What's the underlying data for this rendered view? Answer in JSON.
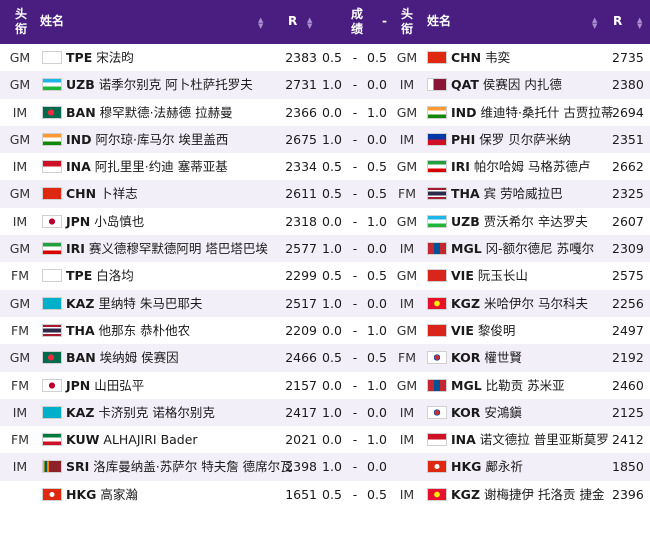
{
  "header": {
    "title_left_line1": "头",
    "title_left_line2": "衔",
    "name_left": "姓名",
    "rating_left": "R",
    "result_line1": "成",
    "result_line2": "绩",
    "dash": "-",
    "title_right_line1": "头",
    "title_right_line2": "衔",
    "name_right": "姓名",
    "rating_right": "R"
  },
  "colors": {
    "header_bg": "#4a1d80",
    "row_alt_bg": "#f3eff8"
  },
  "rows": [
    {
      "t1": "GM",
      "f1": "TPE",
      "n1": "宋法昀",
      "r1": "2383",
      "s1": "0.5",
      "d": "-",
      "s2": "0.5",
      "t2": "GM",
      "f2": "CHN",
      "n2": "韦奕",
      "r2": "2735"
    },
    {
      "t1": "GM",
      "f1": "UZB",
      "n1": "诺季尔别克 阿卜杜萨托罗夫",
      "r1": "2731",
      "s1": "1.0",
      "d": "-",
      "s2": "0.0",
      "t2": "IM",
      "f2": "QAT",
      "n2": "侯赛因 内扎德",
      "r2": "2380"
    },
    {
      "t1": "IM",
      "f1": "BAN",
      "n1": "穆罕默德·法赫德 拉赫曼",
      "r1": "2366",
      "s1": "0.0",
      "d": "-",
      "s2": "1.0",
      "t2": "GM",
      "f2": "IND",
      "n2": "维迪特·桑托什 古贾拉蒂",
      "r2": "2694"
    },
    {
      "t1": "GM",
      "f1": "IND",
      "n1": "阿尔琼·库马尔 埃里盖西",
      "r1": "2675",
      "s1": "1.0",
      "d": "-",
      "s2": "0.0",
      "t2": "IM",
      "f2": "PHI",
      "n2": "保罗 贝尔萨米纳",
      "r2": "2351"
    },
    {
      "t1": "IM",
      "f1": "INA",
      "n1": "阿扎里里·约迪 塞蒂亚基",
      "r1": "2334",
      "s1": "0.5",
      "d": "-",
      "s2": "0.5",
      "t2": "GM",
      "f2": "IRI",
      "n2": "帕尔哈姆 马格苏德卢",
      "r2": "2662"
    },
    {
      "t1": "GM",
      "f1": "CHN",
      "n1": "卜祥志",
      "r1": "2611",
      "s1": "0.5",
      "d": "-",
      "s2": "0.5",
      "t2": "FM",
      "f2": "THA",
      "n2": "宾 劳哈威拉巴",
      "r2": "2325"
    },
    {
      "t1": "IM",
      "f1": "JPN",
      "n1": "小岛慎也",
      "r1": "2318",
      "s1": "0.0",
      "d": "-",
      "s2": "1.0",
      "t2": "GM",
      "f2": "UZB",
      "n2": "贾沃希尔 辛达罗夫",
      "r2": "2607"
    },
    {
      "t1": "GM",
      "f1": "IRI",
      "n1": "赛义德穆罕默德阿明 塔巴塔巴埃",
      "r1": "2577",
      "s1": "1.0",
      "d": "-",
      "s2": "0.0",
      "t2": "IM",
      "f2": "MGL",
      "n2": "冈-额尔德尼 苏嘎尔",
      "r2": "2309"
    },
    {
      "t1": "FM",
      "f1": "TPE",
      "n1": "白洛均",
      "r1": "2299",
      "s1": "0.5",
      "d": "-",
      "s2": "0.5",
      "t2": "GM",
      "f2": "VIE",
      "n2": "阮玉长山",
      "r2": "2575"
    },
    {
      "t1": "GM",
      "f1": "KAZ",
      "n1": "里纳特 朱马巴耶夫",
      "r1": "2517",
      "s1": "1.0",
      "d": "-",
      "s2": "0.0",
      "t2": "IM",
      "f2": "KGZ",
      "n2": "米哈伊尔 马尔科夫",
      "r2": "2256"
    },
    {
      "t1": "FM",
      "f1": "THA",
      "n1": "他那东 恭朴他农",
      "r1": "2209",
      "s1": "0.0",
      "d": "-",
      "s2": "1.0",
      "t2": "GM",
      "f2": "VIE",
      "n2": "黎俊明",
      "r2": "2497"
    },
    {
      "t1": "GM",
      "f1": "BAN",
      "n1": "埃纳姆 侯赛因",
      "r1": "2466",
      "s1": "0.5",
      "d": "-",
      "s2": "0.5",
      "t2": "FM",
      "f2": "KOR",
      "n2": "權世賢",
      "r2": "2192"
    },
    {
      "t1": "FM",
      "f1": "JPN",
      "n1": "山田弘平",
      "r1": "2157",
      "s1": "0.0",
      "d": "-",
      "s2": "1.0",
      "t2": "GM",
      "f2": "MGL",
      "n2": "比勒贡 苏米亚",
      "r2": "2460"
    },
    {
      "t1": "IM",
      "f1": "KAZ",
      "n1": "卡济别克 诺格尔别克",
      "r1": "2417",
      "s1": "1.0",
      "d": "-",
      "s2": "0.0",
      "t2": "IM",
      "f2": "KOR",
      "n2": "安鴻鎭",
      "r2": "2125"
    },
    {
      "t1": "FM",
      "f1": "KUW",
      "n1": "ALHAJIRI Bader",
      "r1": "2021",
      "s1": "0.0",
      "d": "-",
      "s2": "1.0",
      "t2": "IM",
      "f2": "INA",
      "n2": "诺文德拉 普里亚斯莫罗",
      "r2": "2412"
    },
    {
      "t1": "IM",
      "f1": "SRI",
      "n1": "洛库曼纳盖·苏萨尔 特夫詹 德席尔瓦",
      "r1": "2398",
      "s1": "1.0",
      "d": "-",
      "s2": "0.0",
      "t2": "",
      "f2": "HKG",
      "n2": "鄺永祈",
      "r2": "1850"
    },
    {
      "t1": "",
      "f1": "HKG",
      "n1": "高家瀚",
      "r1": "1651",
      "s1": "0.5",
      "d": "-",
      "s2": "0.5",
      "t2": "IM",
      "f2": "KGZ",
      "n2": "谢梅捷伊 托洛贡 捷金",
      "r2": "2396"
    }
  ]
}
